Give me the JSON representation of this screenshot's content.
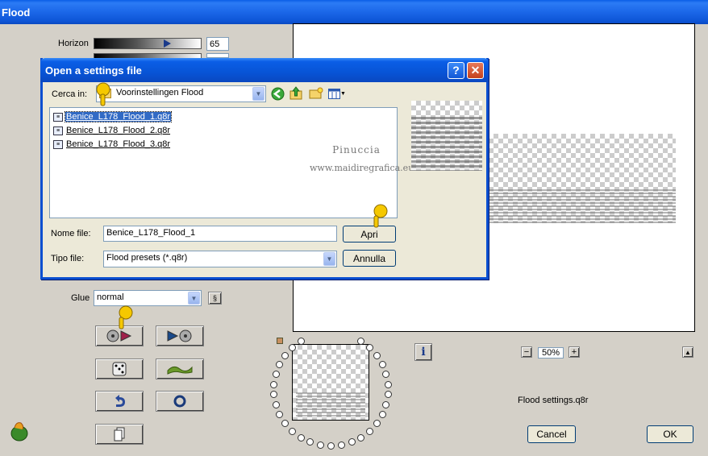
{
  "window": {
    "title": "Flood"
  },
  "params": {
    "horizon_label": "Horizon",
    "horizon_value": "65",
    "horizon_fraction": 0.65,
    "glue_label": "Glue",
    "glue_value": "normal"
  },
  "dialog": {
    "title": "Open a settings file",
    "look_in_label": "Cerca in:",
    "look_in_value": "Voorinstellingen Flood",
    "files": [
      {
        "name": "Benice_L178_Flood_1.q8r",
        "selected": true
      },
      {
        "name": "Benice_L178_Flood_2.q8r",
        "selected": false
      },
      {
        "name": "Benice_L178_Flood_3.q8r",
        "selected": false
      }
    ],
    "watermark_line1": "Pinuccia",
    "watermark_line2": "www.maidiregrafica.eu",
    "filename_label": "Nome file:",
    "filename_value": "Benice_L178_Flood_1",
    "filetype_label": "Tipo file:",
    "filetype_value": "Flood presets (*.q8r)",
    "open_button": "Apri",
    "cancel_button": "Annulla"
  },
  "zoom": {
    "value": "50%"
  },
  "settings_file_label": "Flood settings.q8r",
  "buttons": {
    "cancel": "Cancel",
    "ok": "OK"
  }
}
